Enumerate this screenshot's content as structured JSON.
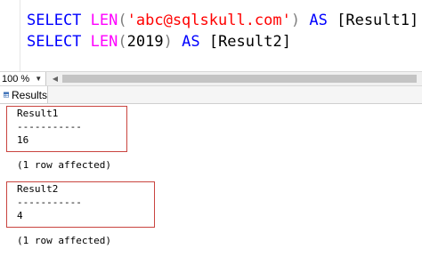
{
  "editor": {
    "line1": {
      "kw1": "SELECT",
      "fn": "LEN",
      "open": "(",
      "str": "'abc@sqlskull.com'",
      "close": ")",
      "kw2": "AS",
      "alias": "[Result1]"
    },
    "line2": {
      "kw1": "SELECT",
      "fn": "LEN",
      "open": "(",
      "num": "2019",
      "close": ")",
      "kw2": "AS",
      "alias": "[Result2]"
    }
  },
  "zoom": {
    "value": "100 %"
  },
  "tabs": {
    "results_label": "Results"
  },
  "results": [
    {
      "header": "Result1",
      "separator": "-----------",
      "value": "16",
      "affected": "(1 row affected)"
    },
    {
      "header": "Result2",
      "separator": "-----------",
      "value": "4",
      "affected": "(1 row affected)"
    }
  ],
  "colors": {
    "keyword": "#0000ff",
    "function": "#ff00ff",
    "string": "#ff0000",
    "highlight_box": "#c9443f"
  },
  "icons": {
    "results_tab": "grid-icon"
  }
}
